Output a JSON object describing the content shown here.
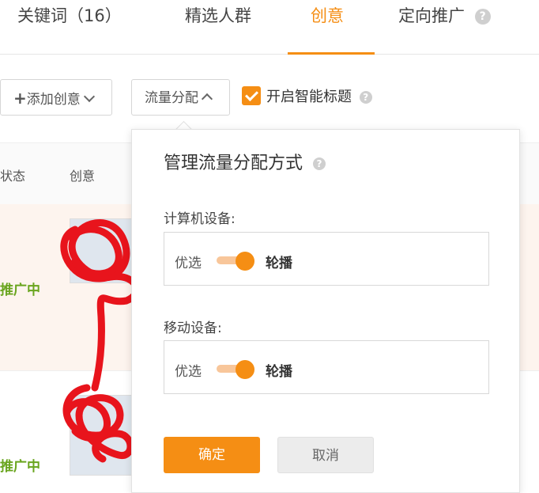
{
  "tabs": [
    {
      "label": "关键词（16）",
      "active": false
    },
    {
      "label": "精选人群",
      "active": false
    },
    {
      "label": "创意",
      "active": true
    },
    {
      "label": "定向推广",
      "active": false
    }
  ],
  "help_icon": "?",
  "toolbar": {
    "add_creative": "添加创意",
    "traffic_allocation": "流量分配",
    "smart_title_label": "开启智能标题",
    "smart_title_checked": true
  },
  "table": {
    "headers": [
      "状态",
      "创意"
    ],
    "rows": [
      {
        "status": "推广中"
      },
      {
        "status": "推广中"
      }
    ]
  },
  "popover": {
    "title": "管理流量分配方式",
    "sections": [
      {
        "label": "计算机设备:",
        "option_left": "优选",
        "option_right": "轮播",
        "selected": "轮播"
      },
      {
        "label": "移动设备:",
        "option_left": "优选",
        "option_right": "轮播",
        "selected": "轮播"
      }
    ],
    "confirm": "确定",
    "cancel": "取消"
  },
  "colors": {
    "accent": "#f58e14",
    "status_green": "#6aa51f",
    "row_highlight": "#fdf4ee",
    "scribble": "#e8141c"
  }
}
